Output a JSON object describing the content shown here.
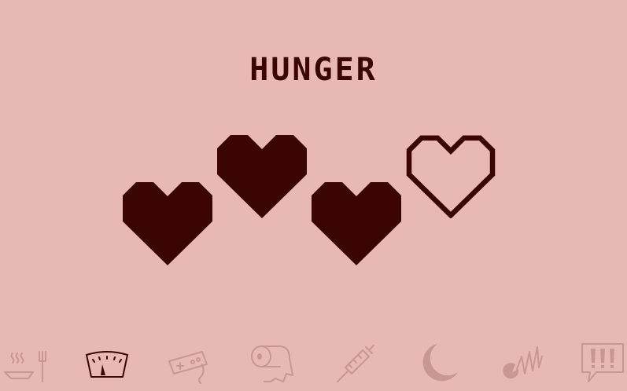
{
  "screen": {
    "title": "HUNGER",
    "hunger_level": 3,
    "hunger_max": 4
  },
  "colors": {
    "background": "#e8b8b4",
    "heart": "#3a0503",
    "inactive_icon": "#c99793",
    "active_icon": "#3a0503"
  },
  "toolbar": {
    "items": [
      {
        "icon": "food-bowl-fork-icon",
        "state": "inactive"
      },
      {
        "icon": "scale-gauge-icon",
        "state": "active"
      },
      {
        "icon": "game-controller-icon",
        "state": "inactive"
      },
      {
        "icon": "toilet-paper-icon",
        "state": "inactive"
      },
      {
        "icon": "syringe-icon",
        "state": "inactive"
      },
      {
        "icon": "moon-icon",
        "state": "inactive"
      },
      {
        "icon": "discipline-icon",
        "state": "inactive"
      },
      {
        "icon": "attention-alert-icon",
        "state": "inactive"
      }
    ]
  }
}
